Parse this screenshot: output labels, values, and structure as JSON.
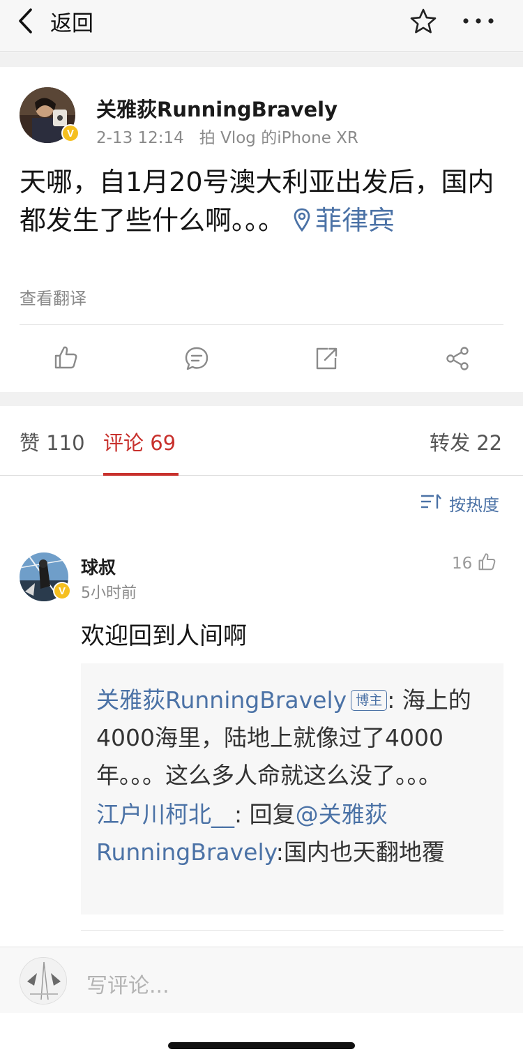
{
  "nav": {
    "back_label": "返回"
  },
  "post": {
    "author": "关雅荻RunningBravely",
    "date": "2-13 12:14",
    "source": "拍 Vlog 的iPhone XR",
    "text": "天哪，自1月20号澳大利亚出发后，国内都发生了些什么啊。。。 ",
    "location": "菲律宾",
    "translate": "查看翻译",
    "verified_badge": "V"
  },
  "tabs": {
    "likes": "赞 110",
    "comments": "评论 69",
    "reposts": "转发 22"
  },
  "sort_label": "按热度",
  "comment": {
    "name": "球叔",
    "time": "5小时前",
    "likes": "16",
    "text": "欢迎回到人间啊",
    "reply1_user": "关雅荻RunningBravely",
    "reply1_badge": "博主",
    "reply1_text": ": 海上的4000海里，陆地上就像过了4000年。。。这么多人命就这么没了。。。",
    "reply2_user": "江户川柯北__",
    "reply2_mid": ": 回复",
    "reply2_mention": "@关雅荻RunningBravely",
    "reply2_text": ":国内也天翻地覆"
  },
  "bottom": {
    "placeholder": "写评论..."
  },
  "colors": {
    "accent_red": "#c8312d",
    "link_blue": "#4b72a6",
    "verified_yellow": "#f5bf1f"
  },
  "icons": [
    "chevron-left-icon",
    "star-icon",
    "more-icon",
    "location-pin-icon",
    "thumb-up-icon",
    "comment-icon",
    "repost-icon",
    "share-icon",
    "sort-icon"
  ]
}
